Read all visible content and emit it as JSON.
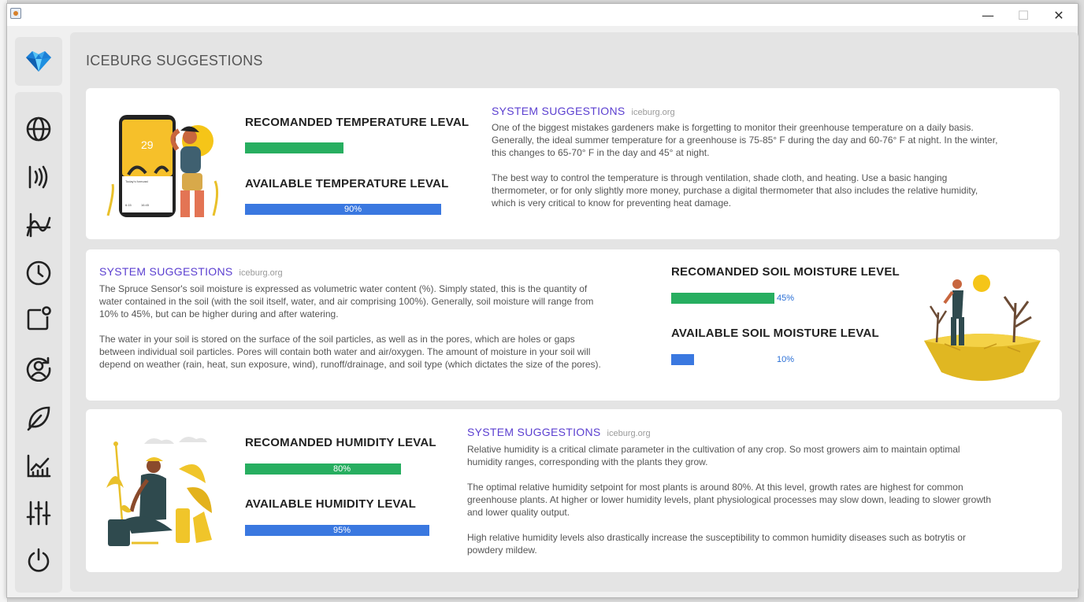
{
  "window": {
    "minimize_glyph": "—",
    "maximize_glyph": "☐",
    "close_glyph": "✕"
  },
  "sidebar": {
    "logo_icon": "iceberg-logo-icon",
    "items": [
      {
        "icon": "globe-icon"
      },
      {
        "icon": "signal-waves-icon"
      },
      {
        "icon": "graph-wave-icon"
      },
      {
        "icon": "timer-icon"
      },
      {
        "icon": "notification-square-icon"
      },
      {
        "icon": "user-refresh-icon"
      },
      {
        "icon": "leaf-icon"
      },
      {
        "icon": "chart-icon"
      },
      {
        "icon": "sliders-icon"
      },
      {
        "icon": "power-icon"
      }
    ]
  },
  "page": {
    "title": "ICEBURG SUGGESTIONS"
  },
  "colors": {
    "recommended_bar": "#27ae60",
    "available_bar": "#3a78e0",
    "suggestion_title": "#5b3fd0"
  },
  "temperature": {
    "recommended_title": "RECOMANDED TEMPERATURE LEVAL",
    "recommended_value": 50,
    "recommended_label": "50%",
    "available_title": "AVAILABLE TEMPERATURE LEVAL",
    "available_value": 90,
    "available_label": "90%",
    "suggestion_title": "SYSTEM SUGGESTIONS",
    "suggestion_site": "iceburg.org",
    "paragraphs": [
      "One of the biggest mistakes gardeners make is forgetting to monitor their greenhouse temperature on a daily basis. Generally, the ideal summer temperature for a greenhouse is 75-85° F during the day and 60-76° F at night. In the winter, this changes to 65-70° F in the day and 45° at night.",
      "The best way to control the temperature is through ventilation, shade cloth, and heating. Use a basic hanging thermometer, or for only slightly more money, purchase a digital thermometer that also includes the relative humidity, which is very critical to know for preventing heat damage."
    ],
    "phone_temp": "29",
    "phone_times": [
      "6:15",
      "16:45"
    ],
    "phone_caption": "Today's forecast"
  },
  "soil": {
    "recommended_title": "RECOMANDED SOIL MOISTURE LEVEL",
    "recommended_value": 45,
    "recommended_label": "45%",
    "available_title": "AVAILABLE SOIL MOISTURE LEVAL",
    "available_value": 10,
    "available_label": "10%",
    "suggestion_title": "SYSTEM SUGGESTIONS",
    "suggestion_site": "iceburg.org",
    "paragraphs": [
      "The Spruce Sensor's soil moisture is expressed as volumetric water content (%).  Simply stated, this is the quantity of water contained in the soil (with the soil itself, water, and air comprising 100%).  Generally, soil moisture will range from 10% to 45%, but can be higher during and after watering.",
      "The water in your soil is stored on the surface of the soil particles, as well as in the pores, which are holes or gaps between individual soil particles. Pores will contain both water and air/oxygen.  The amount of moisture in your soil will depend on weather (rain, heat, sun exposure, wind), runoff/drainage, and soil type (which dictates the size of the pores)."
    ]
  },
  "humidity": {
    "recommended_title": "RECOMANDED HUMIDITY LEVAL",
    "recommended_value": 80,
    "recommended_label": "80%",
    "available_title": "AVAILABLE HUMIDITY LEVAL",
    "available_value": 95,
    "available_label": "95%",
    "suggestion_title": "SYSTEM SUGGESTIONS",
    "suggestion_site": "iceburg.org",
    "paragraphs": [
      "Relative humidity is a critical climate parameter in the cultivation of any crop. So most growers aim to maintain optimal humidity ranges, corresponding with the plants they grow.",
      "The optimal relative humidity setpoint for most plants is around 80%. At this level, growth rates are highest for common greenhouse plants. At higher or lower humidity levels, plant physiological processes may slow down, leading to slower growth and lower quality output.",
      "High relative humidity levels also drastically increase the susceptibility to common humidity diseases such as botrytis or powdery mildew."
    ]
  }
}
